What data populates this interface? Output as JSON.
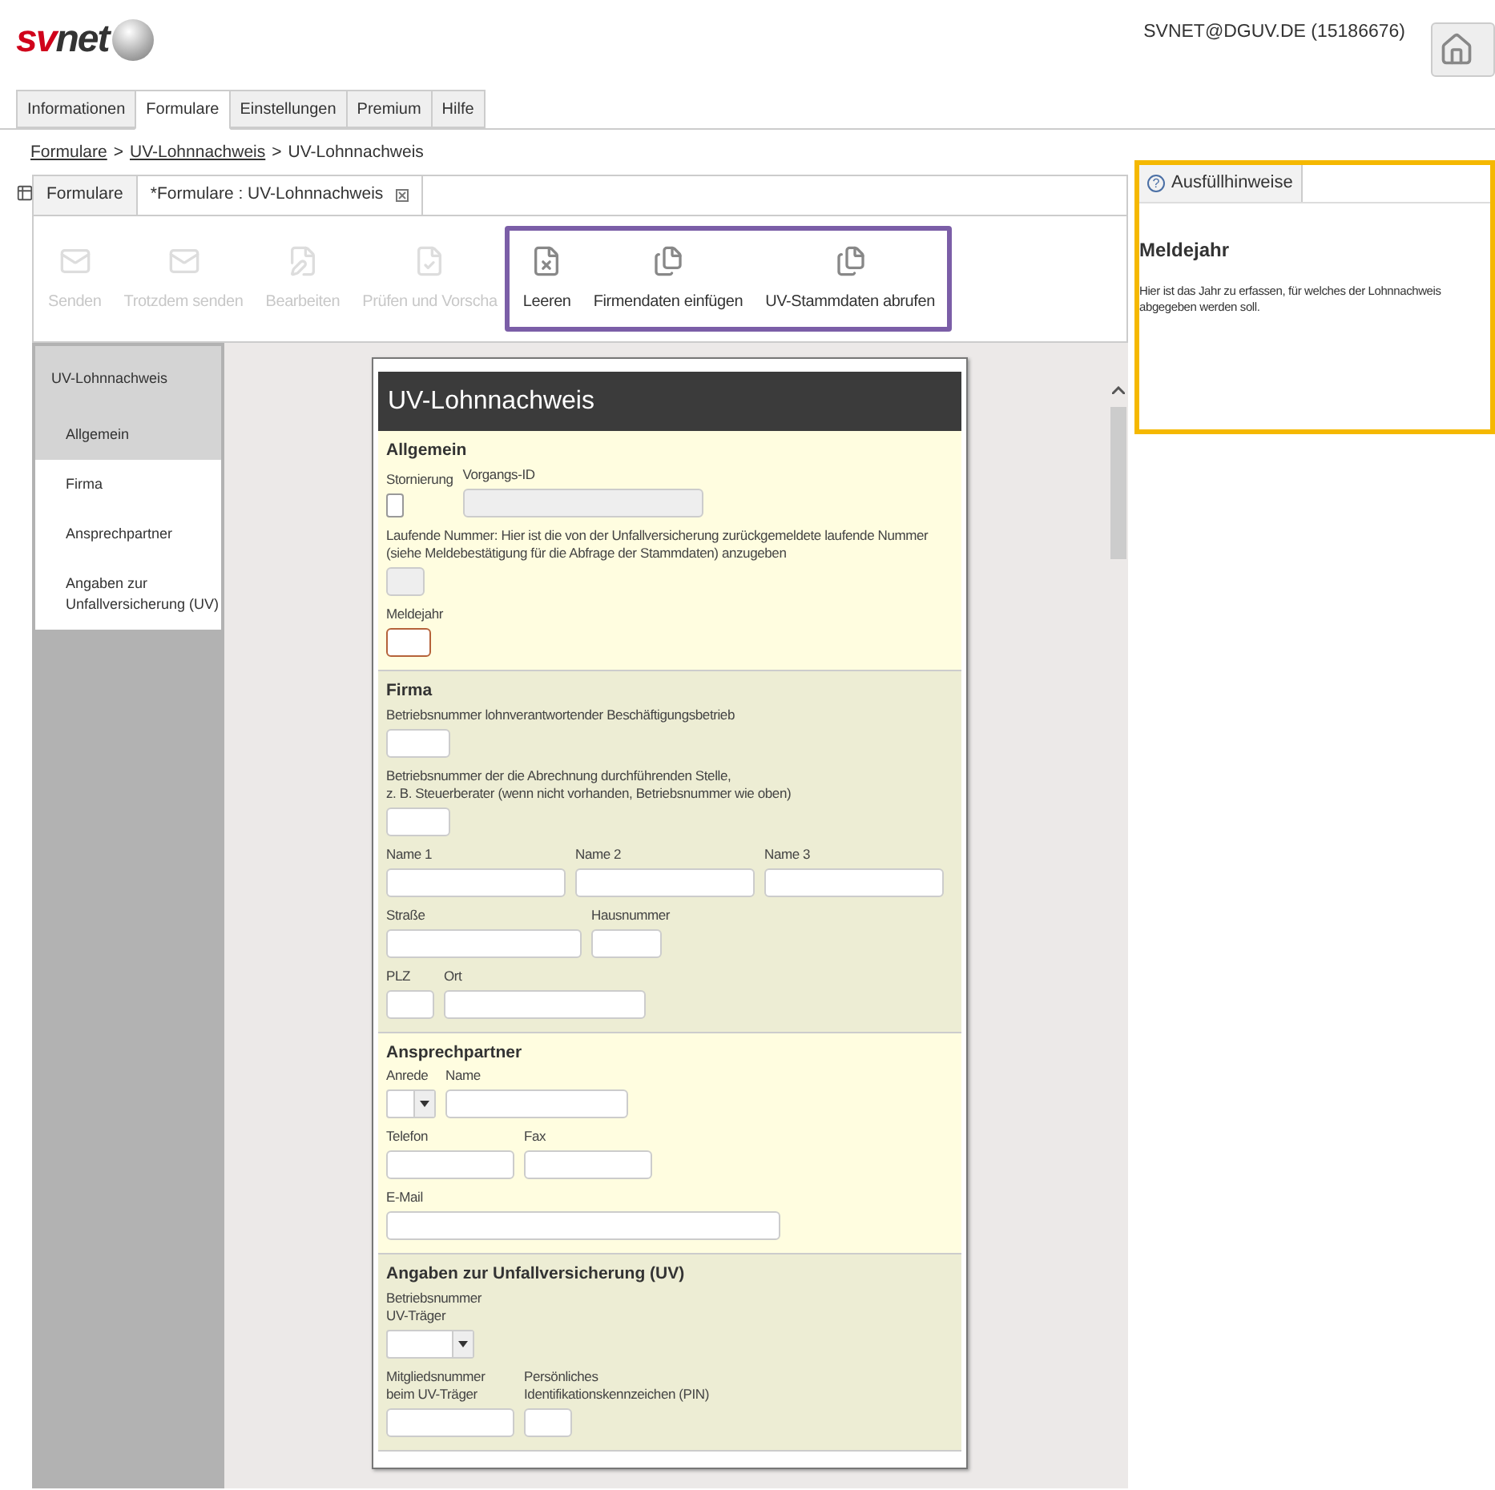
{
  "header": {
    "logo": {
      "part_1": "sv",
      "part_2": "net"
    },
    "user": "SVNET@DGUV.DE (15186676)"
  },
  "main_tabs": [
    {
      "label": "Informationen",
      "selected": false
    },
    {
      "label": "Formulare",
      "selected": true
    },
    {
      "label": "Einstellungen",
      "selected": false
    },
    {
      "label": "Premium",
      "selected": false
    },
    {
      "label": "Hilfe",
      "selected": false
    }
  ],
  "breadcrumb": {
    "separator": ">",
    "items": [
      {
        "label": "Formulare",
        "link": true
      },
      {
        "label": "UV-Lohnnachweis",
        "link": true
      },
      {
        "label": "UV-Lohnnachweis",
        "link": false
      }
    ]
  },
  "editor_tabs": [
    {
      "label": "Formulare",
      "selected": false,
      "closable": false
    },
    {
      "label": "*Formulare : UV-Lohnnachweis",
      "selected": true,
      "closable": true
    }
  ],
  "toolbar": {
    "groups": [
      {
        "highlighted": false,
        "buttons": [
          {
            "label": "Senden",
            "disabled": true
          },
          {
            "label": "Trotzdem senden",
            "disabled": true
          },
          {
            "label": "Bearbeiten",
            "disabled": true
          },
          {
            "label": "Prüfen und Vorscha",
            "disabled": true
          }
        ]
      },
      {
        "highlighted": true,
        "buttons": [
          {
            "label": "Leeren",
            "disabled": false
          },
          {
            "label": "Firmendaten einfügen",
            "disabled": false
          },
          {
            "label": "UV-Stammdaten abrufen",
            "disabled": false
          }
        ]
      }
    ]
  },
  "nav": {
    "title": "UV-Lohnnachweis",
    "items": [
      {
        "label": "Allgemein",
        "selected": true
      },
      {
        "label": "Firma",
        "selected": false
      },
      {
        "label": "Ansprechpartner",
        "selected": false
      },
      {
        "label": "Angaben zur\nUnfallversicherung (UV)",
        "selected": false
      }
    ]
  },
  "form": {
    "title": "UV-Lohnnachweis",
    "sections": [
      {
        "title": "Allgemein",
        "color": "#fffde0",
        "rows": [
          [
            {
              "kind": "checkbox",
              "label": "Stornierung",
              "checked": false
            },
            {
              "kind": "text",
              "label": "Vorgangs-ID",
              "disabled": true,
              "focused": false
            }
          ],
          [
            {
              "kind": "text",
              "label": "Laufende Nummer: Hier ist die von der Unfallversicherung zurückgemeldete laufende Nummer\n(siehe Meldebestätigung für die Abfrage der Stammdaten) anzugeben",
              "disabled": true,
              "focused": false
            }
          ],
          [
            {
              "kind": "text",
              "label": "Meldejahr",
              "disabled": false,
              "focused": true
            }
          ]
        ]
      },
      {
        "title": "Firma",
        "color": "#ededd4",
        "rows": [
          [
            {
              "kind": "text",
              "label": "Betriebsnummer lohnverantwortender Beschäftigungsbetrieb",
              "disabled": false,
              "focused": false
            }
          ],
          [
            {
              "kind": "text",
              "label": "Betriebsnummer der die Abrechnung durchführenden Stelle,\nz. B. Steuerberater (wenn nicht vorhanden, Betriebsnummer wie oben)",
              "disabled": false,
              "focused": false
            }
          ],
          [
            {
              "kind": "text",
              "label": "Name 1",
              "disabled": false,
              "focused": false
            },
            {
              "kind": "text",
              "label": "Name 2",
              "disabled": false,
              "focused": false
            },
            {
              "kind": "text",
              "label": "Name 3",
              "disabled": false,
              "focused": false
            }
          ],
          [
            {
              "kind": "text",
              "label": "Straße",
              "disabled": false,
              "focused": false
            },
            {
              "kind": "text",
              "label": "Hausnummer",
              "disabled": false,
              "focused": false
            }
          ],
          [
            {
              "kind": "text",
              "label": "PLZ",
              "disabled": false,
              "focused": false
            },
            {
              "kind": "text",
              "label": "Ort",
              "disabled": false,
              "focused": false
            }
          ]
        ]
      },
      {
        "title": "Ansprechpartner",
        "color": "#fffde0",
        "rows": [
          [
            {
              "kind": "select",
              "label": "Anrede"
            },
            {
              "kind": "text",
              "label": "Name",
              "disabled": false,
              "focused": false
            }
          ],
          [
            {
              "kind": "text",
              "label": "Telefon",
              "disabled": false,
              "focused": false
            },
            {
              "kind": "text",
              "label": "Fax",
              "disabled": false,
              "focused": false
            }
          ],
          [
            {
              "kind": "text",
              "label": "E-Mail",
              "disabled": false,
              "focused": false
            }
          ]
        ]
      },
      {
        "title": "Angaben zur Unfallversicherung (UV)",
        "color": "#ededd4",
        "rows": [
          [
            {
              "kind": "select",
              "label": "Betriebsnummer\nUV-Träger"
            }
          ],
          [
            {
              "kind": "text",
              "label": "Mitgliedsnummer\nbeim UV-Träger",
              "disabled": false,
              "focused": false
            },
            {
              "kind": "text",
              "label": "Persönliches\nIdentifikationskennzeichen (PIN)",
              "disabled": false,
              "focused": false
            }
          ]
        ]
      }
    ]
  },
  "help_panel": {
    "highlighted": true,
    "tab_icon": "?",
    "tab": "Ausfüllhinweise",
    "heading": "Meldejahr",
    "text": "Hier ist das Jahr zu erfassen, für welches der Lohnnachweis abgegeben werden soll."
  }
}
